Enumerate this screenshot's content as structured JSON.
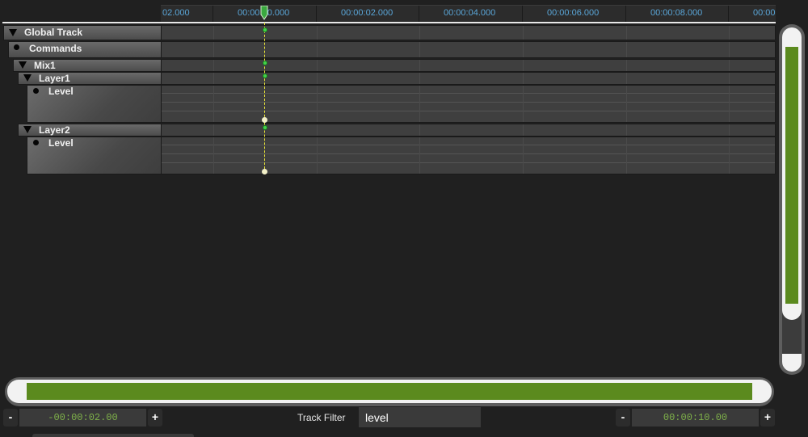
{
  "ruler": {
    "labels": [
      "02.000",
      "00:00:00.000",
      "00:00:02.000",
      "00:00:04.000",
      "00:00:06.000",
      "00:00:08.000",
      "00:00"
    ]
  },
  "tracks": {
    "global": "Global Track",
    "commands": "Commands",
    "mix1": "Mix1",
    "layer1": "Layer1",
    "layer1_level": "Level",
    "layer2": "Layer2",
    "layer2_level": "Level"
  },
  "playhead": {
    "position_seconds": 0
  },
  "scroll": {
    "vertical_visible_fraction": 0.85,
    "horizontal_visible_fraction": 1.0
  },
  "bottom": {
    "minus_label": "-",
    "plus_label": "+",
    "start_time": "-00:00:02.00",
    "end_time": "00:00:10.00",
    "filter_label": "Track Filter",
    "filter_value": "level"
  },
  "colors": {
    "background": "#202020",
    "accent_green": "#5b8a1e",
    "ruler_text": "#5aa6d8",
    "playhead": "#e8e43a",
    "time_text": "#7fb24a"
  },
  "icons": {
    "expander": "triangle-down-icon",
    "bullet": "bullet-icon",
    "playhead": "playhead-marker-icon"
  }
}
